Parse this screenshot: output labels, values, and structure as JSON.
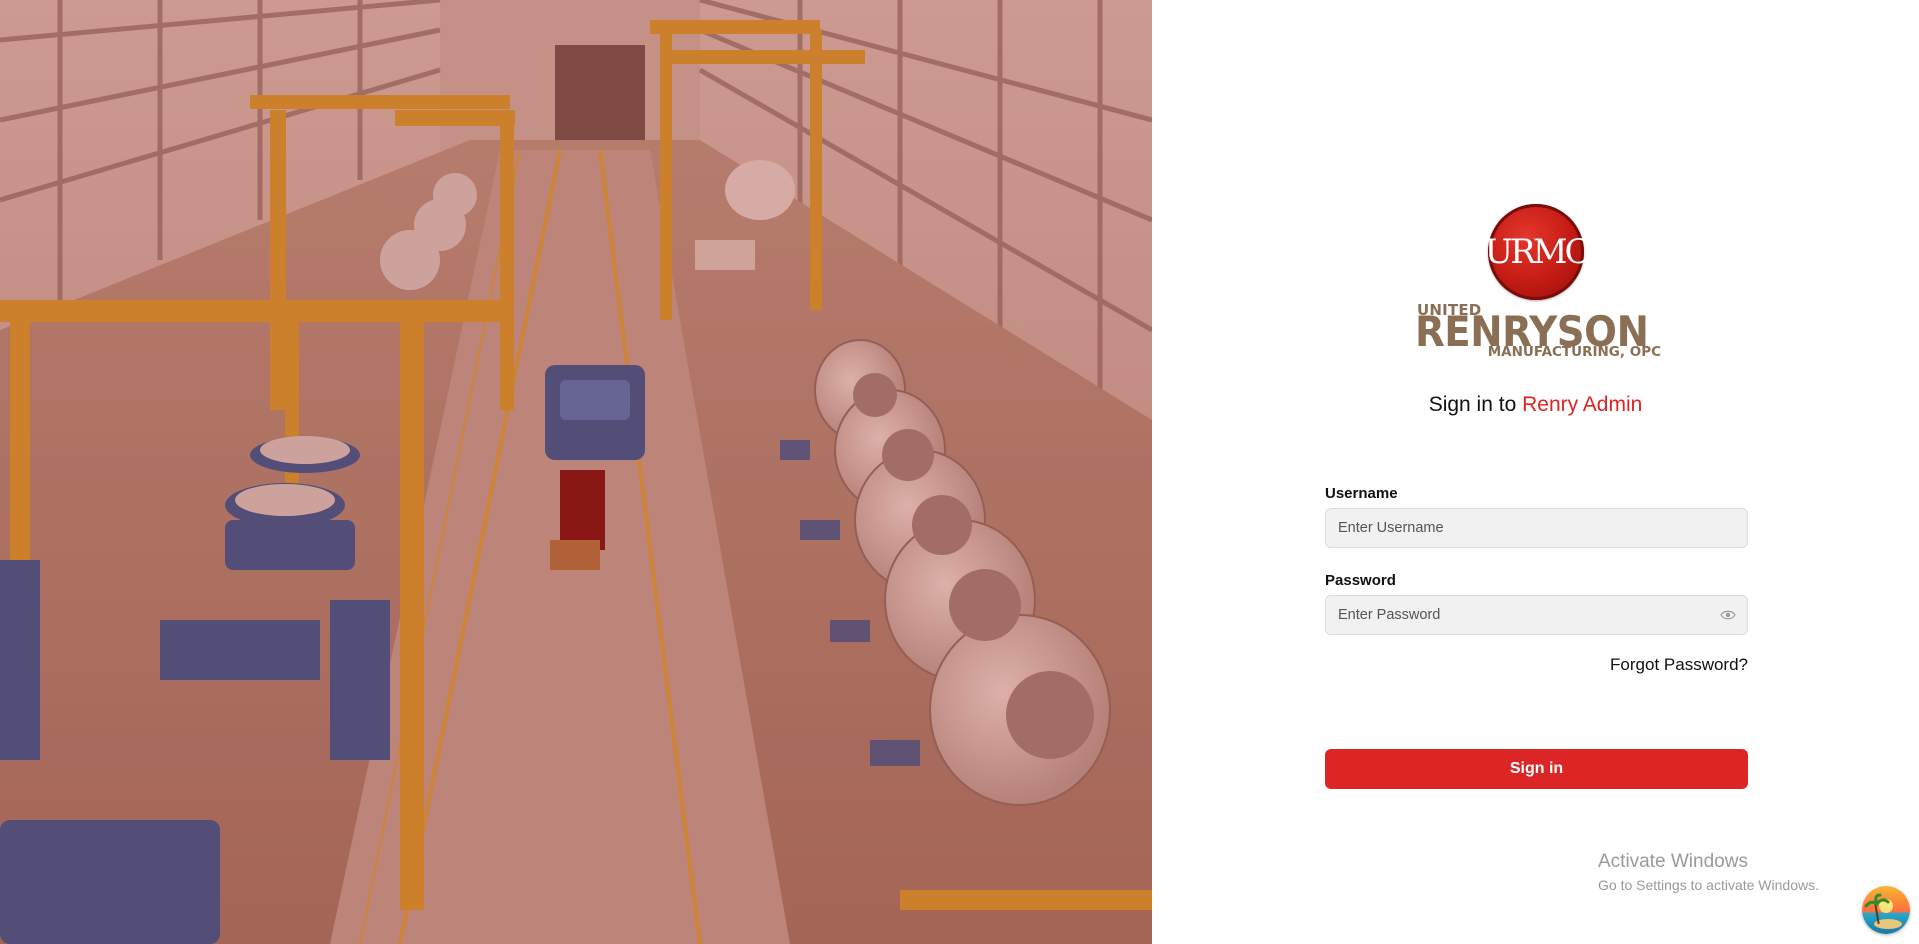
{
  "hero": {
    "image_alt": "Factory floor with turbine nacelles"
  },
  "logo": {
    "emblem_text": "URMC",
    "line1": "UNITED",
    "line2": "RENRYSON",
    "line3": "MANUFACTURING, OPC",
    "brand_color": "#8a6f54",
    "emblem_color": "#c21a14"
  },
  "headline": {
    "prefix": "Sign in to ",
    "brand": "Renry Admin",
    "brand_color": "#e02323"
  },
  "form": {
    "username_label": "Username",
    "username_placeholder": "Enter Username",
    "username_value": "",
    "password_label": "Password",
    "password_placeholder": "Enter Password",
    "password_value": "",
    "password_toggle_icon": "eye-icon",
    "forgot_label": "Forgot Password?",
    "submit_label": "Sign in",
    "accent_color": "#dc2626"
  },
  "watermark": {
    "title": "Activate Windows",
    "subtitle": "Go to Settings to activate Windows."
  },
  "corner_widget": {
    "icon": "beach-island-icon"
  }
}
